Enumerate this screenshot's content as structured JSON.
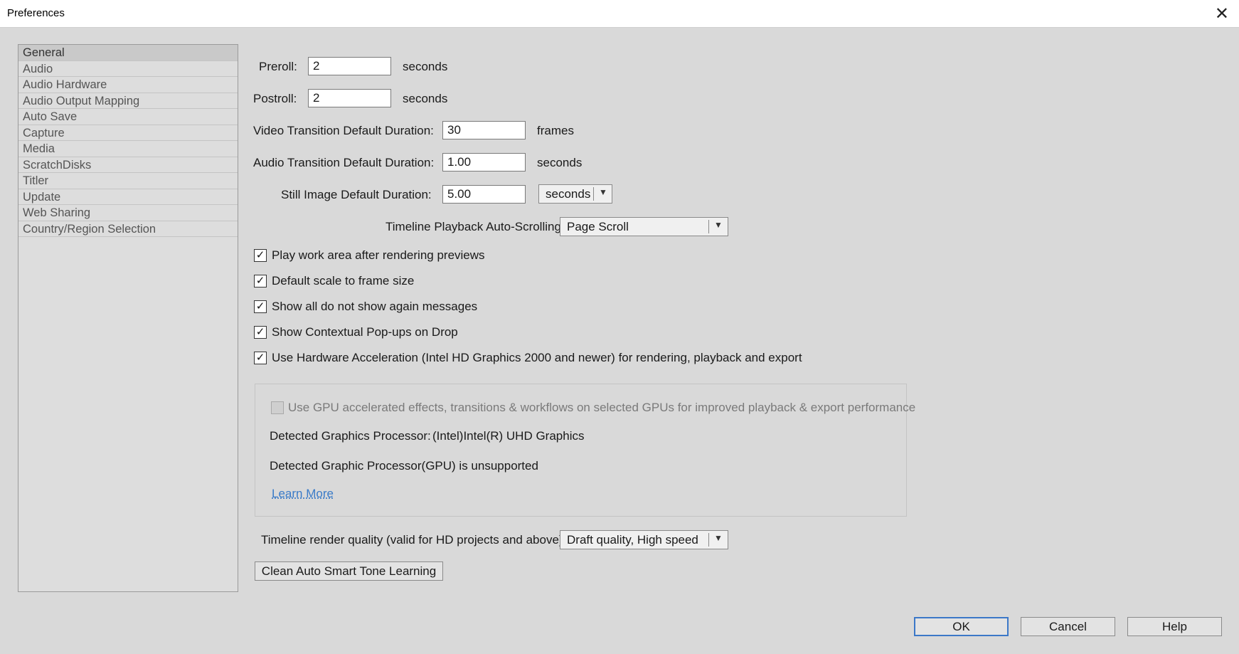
{
  "window": {
    "title": "Preferences"
  },
  "sidebar": {
    "items": [
      {
        "label": "General",
        "selected": true
      },
      {
        "label": "Audio"
      },
      {
        "label": "Audio Hardware"
      },
      {
        "label": "Audio Output Mapping"
      },
      {
        "label": "Auto Save"
      },
      {
        "label": "Capture"
      },
      {
        "label": "Media"
      },
      {
        "label": "ScratchDisks"
      },
      {
        "label": "Titler"
      },
      {
        "label": "Update"
      },
      {
        "label": "Web Sharing"
      },
      {
        "label": "Country/Region Selection"
      }
    ]
  },
  "general": {
    "preroll": {
      "label": "Preroll:",
      "value": "2",
      "unit": "seconds"
    },
    "postroll": {
      "label": "Postroll:",
      "value": "2",
      "unit": "seconds"
    },
    "video_transition": {
      "label": "Video Transition Default Duration:",
      "value": "30",
      "unit": "frames"
    },
    "audio_transition": {
      "label": "Audio Transition Default Duration:",
      "value": "1.00",
      "unit": "seconds"
    },
    "still_image": {
      "label": "Still Image Default Duration:",
      "value": "5.00",
      "unit_selected": "seconds"
    },
    "autoscroll": {
      "label": "Timeline Playback Auto-Scrolling:",
      "selected": "Page Scroll"
    },
    "checkboxes": [
      {
        "label": "Play work area after rendering previews",
        "checked": true
      },
      {
        "label": "Default scale to frame size",
        "checked": true
      },
      {
        "label": "Show all do not show again messages",
        "checked": true
      },
      {
        "label": "Show Contextual Pop-ups on Drop",
        "checked": true
      },
      {
        "label": "Use Hardware Acceleration (Intel HD Graphics 2000 and newer) for rendering, playback and export",
        "checked": true
      }
    ],
    "gpu": {
      "checkbox_label": "Use GPU accelerated effects, transitions & workflows on selected GPUs for improved playback & export performance",
      "checked": false,
      "detected_label": "Detected Graphics Processor:",
      "detected_value": "(Intel)Intel(R) UHD Graphics",
      "unsupported_text": "Detected Graphic Processor(GPU) is unsupported",
      "learn_more": "Learn More"
    },
    "render_quality": {
      "label": "Timeline render quality (valid for HD projects and above):",
      "selected": "Draft quality, High speed"
    },
    "clean_button": "Clean Auto Smart Tone Learning"
  },
  "footer": {
    "ok": "OK",
    "cancel": "Cancel",
    "help": "Help"
  },
  "icons": {
    "close": "close-icon",
    "dropdown": "chevron-down-icon",
    "check": "check-icon"
  },
  "colors": {
    "background": "#d9d9d9",
    "link": "#3a7bc8",
    "default_button_border": "#3c78c8"
  }
}
